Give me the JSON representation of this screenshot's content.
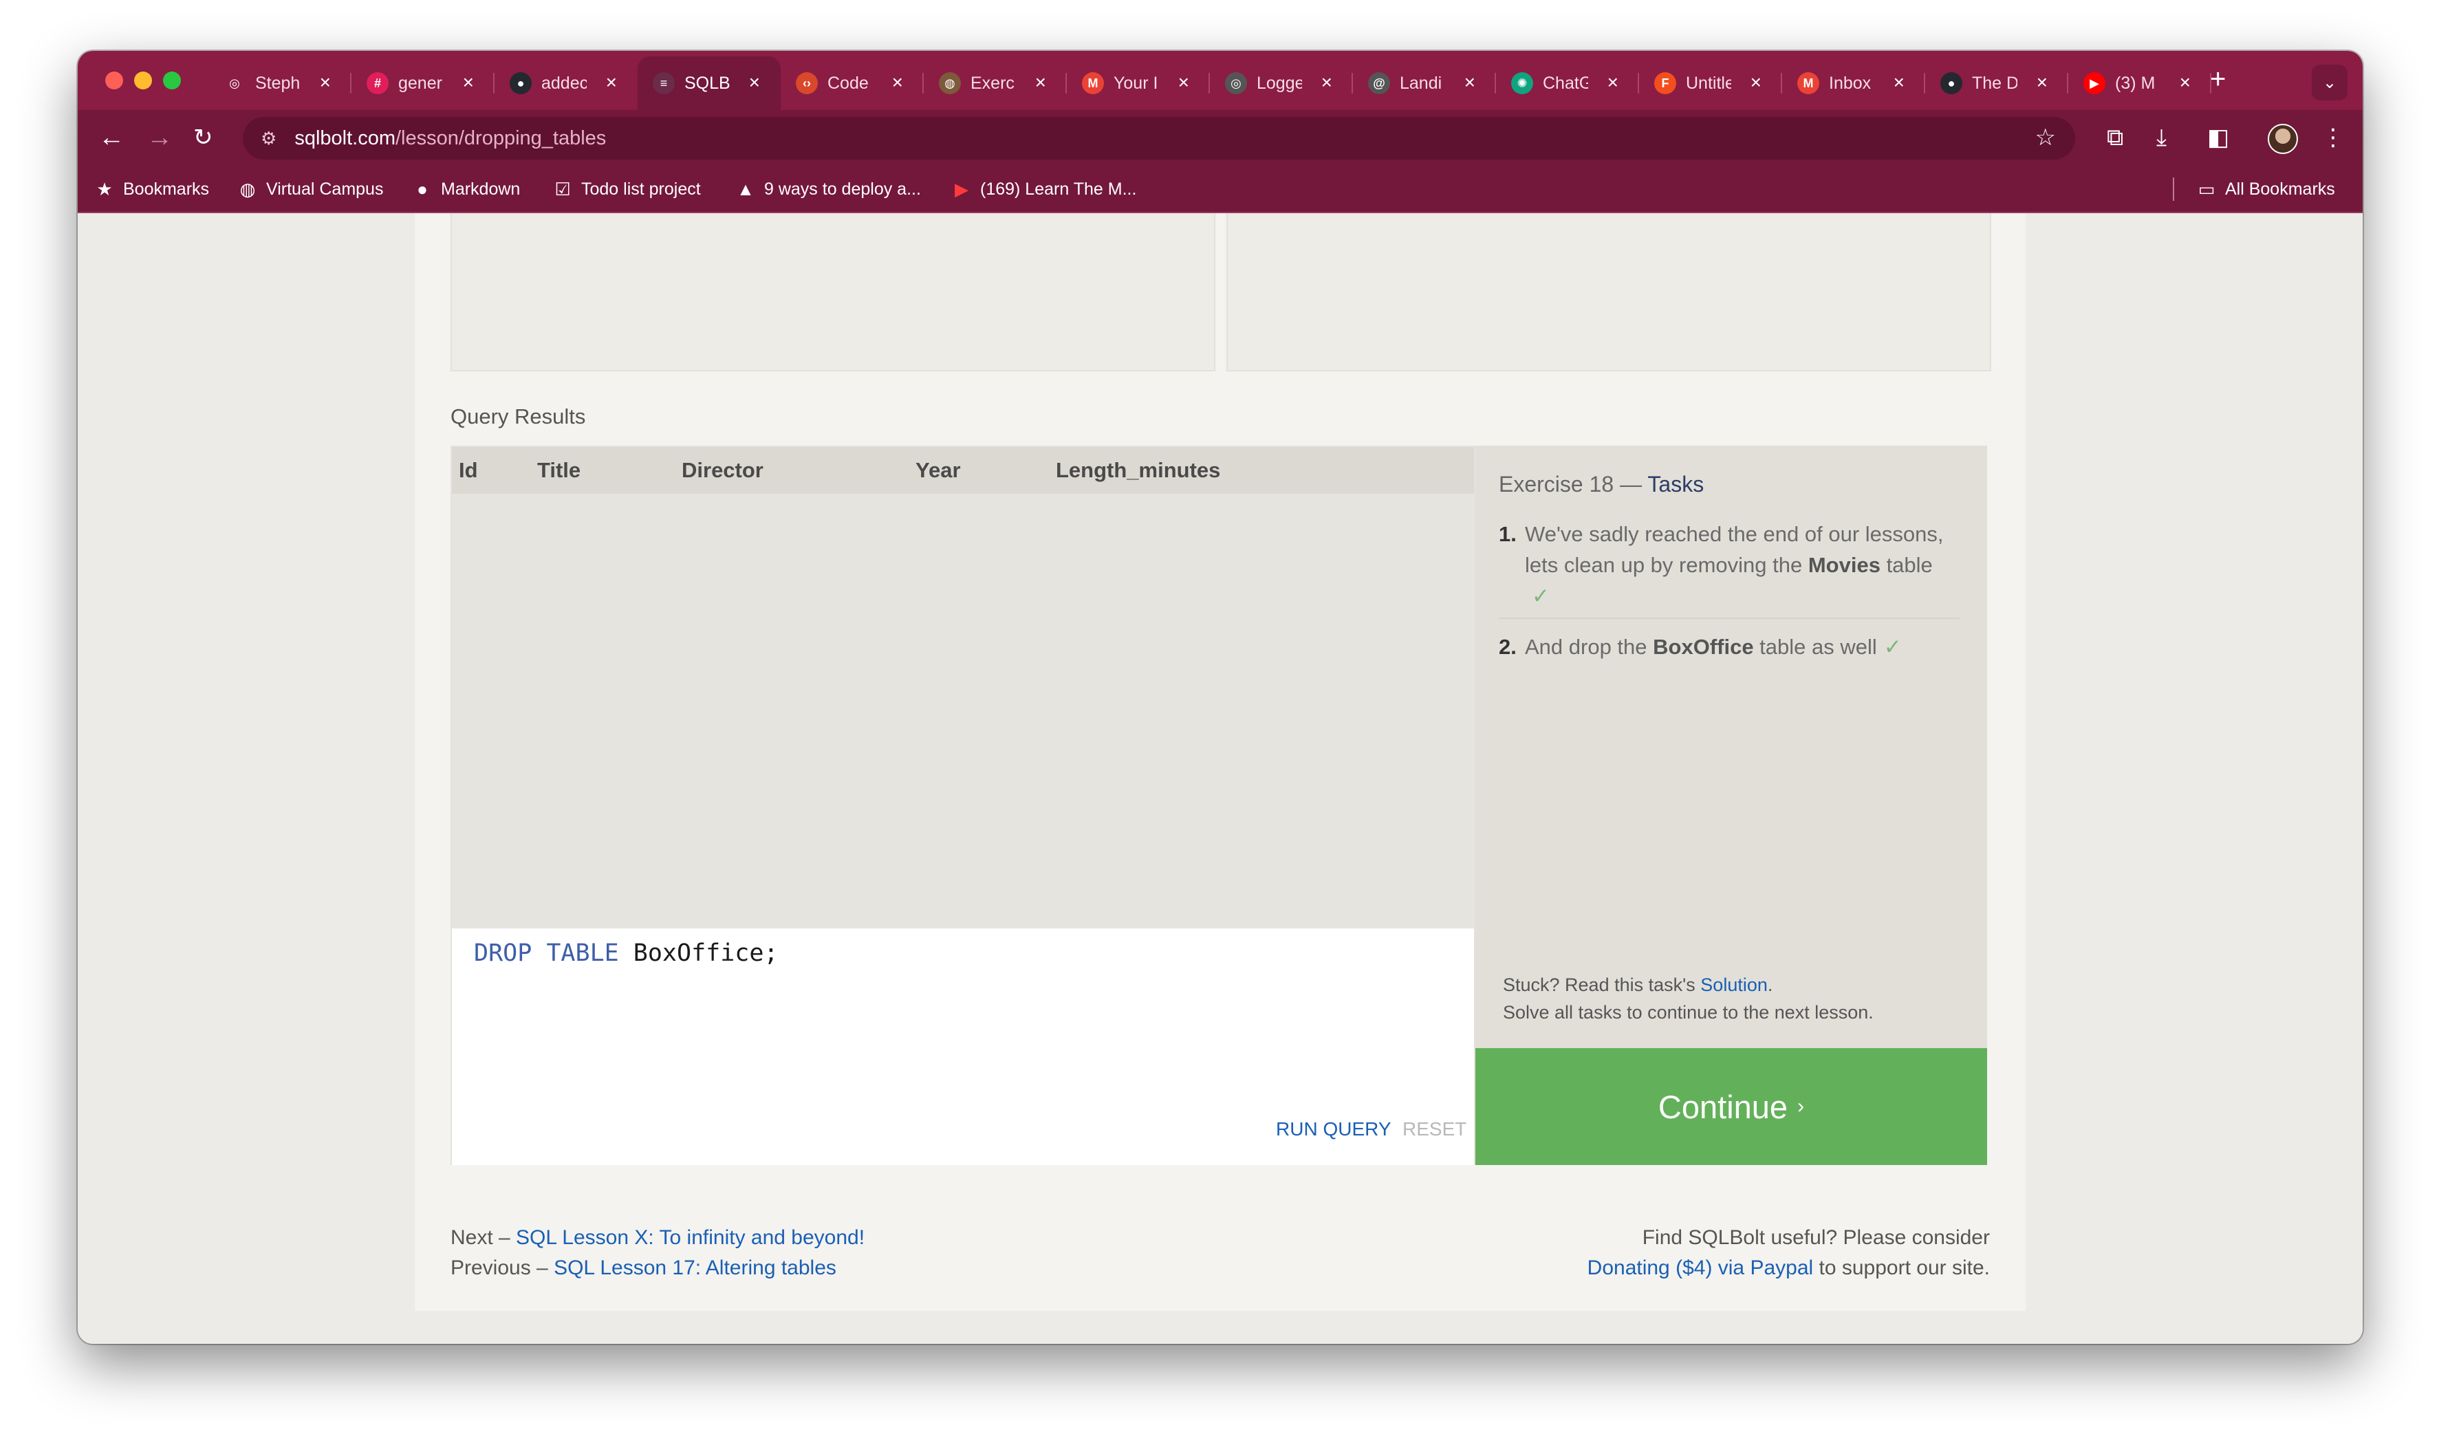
{
  "browser": {
    "tabs": [
      {
        "label": "Steph",
        "icon": "github-circle-icon",
        "color": "#8b1c44"
      },
      {
        "label": "gener",
        "icon": "slack-icon",
        "color": "#e01e5a"
      },
      {
        "label": "addec",
        "icon": "github-icon",
        "color": "#24292f"
      },
      {
        "label": "SQLB",
        "icon": "database-icon",
        "color": "#6a2c48"
      },
      {
        "label": "Code",
        "icon": "code-icon",
        "color": "#d9482b"
      },
      {
        "label": "Exerc",
        "icon": "globe-icon",
        "color": "#7c5a3a"
      },
      {
        "label": "Your I",
        "icon": "gmail-icon",
        "color": "#ea4335"
      },
      {
        "label": "Logge",
        "icon": "hc-icon",
        "color": "#555555"
      },
      {
        "label": "Landi",
        "icon": "at-icon",
        "color": "#555555"
      },
      {
        "label": "ChatG",
        "icon": "chatgpt-icon",
        "color": "#10a37f"
      },
      {
        "label": "Untitle",
        "icon": "figma-icon",
        "color": "#f24e1e"
      },
      {
        "label": "Inbox",
        "icon": "gmail-icon",
        "color": "#ea4335"
      },
      {
        "label": "The D",
        "icon": "github-icon",
        "color": "#24292f"
      },
      {
        "label": "(3) M",
        "icon": "youtube-icon",
        "color": "#ff0000"
      }
    ],
    "url_host": "sqlbolt.com",
    "url_path": "/lesson/dropping_tables",
    "bookmarks": [
      {
        "label": "Bookmarks",
        "icon": "star-icon"
      },
      {
        "label": "Virtual Campus",
        "icon": "globe-icon"
      },
      {
        "label": "Markdown",
        "icon": "github-icon"
      },
      {
        "label": "Todo list project",
        "icon": "checkbox-icon"
      },
      {
        "label": "9 ways to deploy a...",
        "icon": "rocket-icon"
      },
      {
        "label": "(169) Learn The M...",
        "icon": "youtube-icon"
      }
    ],
    "all_bookmarks": "All Bookmarks"
  },
  "lesson": {
    "query_results_label": "Query Results",
    "columns": [
      "Id",
      "Title",
      "Director",
      "Year",
      "Length_minutes"
    ],
    "query": {
      "keyword": "DROP TABLE",
      "rest": " BoxOffice;"
    },
    "run_label": "RUN QUERY",
    "reset_label": "RESET",
    "exercise": {
      "prefix": "Exercise 18 — ",
      "tasks_label": "Tasks",
      "items": [
        {
          "num": "1.",
          "pre": "We've sadly reached the end of our lessons, lets clean up by removing the ",
          "bold": "Movies",
          "post": " table",
          "check": "✓"
        },
        {
          "num": "2.",
          "pre": "And drop the ",
          "bold": "BoxOffice",
          "post": " table as well",
          "check": "✓"
        }
      ],
      "stuck_pre": "Stuck? Read this task's ",
      "stuck_link": "Solution",
      "stuck_post": ".",
      "solve_all": "Solve all tasks to continue to the next lesson."
    },
    "continue_label": "Continue",
    "continue_chevron": "›"
  },
  "footer": {
    "next_prefix": "Next – ",
    "next_link": "SQL Lesson X: To infinity and beyond!",
    "prev_prefix": "Previous – ",
    "prev_link": "SQL Lesson 17: Altering tables",
    "right_line1": "Find SQLBolt useful? Please consider",
    "donate_link": "Donating ($4) via Paypal",
    "right_line2_post": " to support our site."
  }
}
